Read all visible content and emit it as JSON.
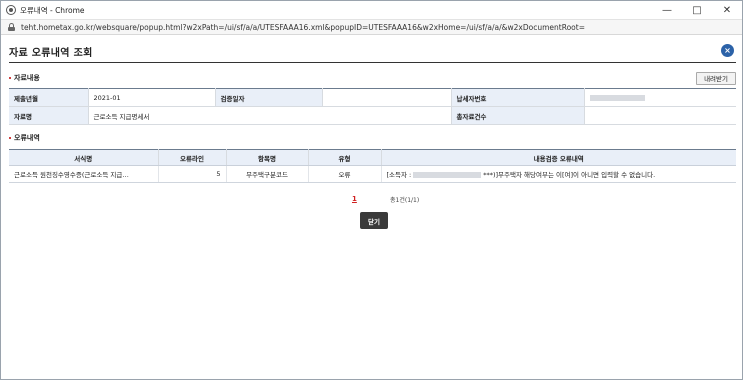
{
  "window": {
    "title": "오류내역 - Chrome",
    "url": "teht.hometax.go.kr/websquare/popup.html?w2xPath=/ui/sf/a/a/UTESFAAA16.xml&popupID=UTESFAAA16&w2xHome=/ui/sf/a/a/&w2xDocumentRoot="
  },
  "page": {
    "title": "자료 오류내역 조회",
    "close_icon": "×"
  },
  "data_section": {
    "title": "자료내용",
    "download_label": "내려받기",
    "rows": [
      {
        "label1": "제출년월",
        "value1": "2021-01",
        "label2": "검증일자",
        "value2": "",
        "label3": "납세자번호",
        "value3": ""
      },
      {
        "label1": "자료명",
        "value1": "근로소득 지급명세서",
        "label2": "",
        "value2": "",
        "label3": "총자료건수",
        "value3": ""
      }
    ]
  },
  "error_section": {
    "title": "오류내역",
    "headers": [
      "서식명",
      "오류라인",
      "항목명",
      "유형",
      "내용검증 오류내역"
    ],
    "rows": [
      {
        "form": "근로소득 원천징수영수증(근로소득 지급…",
        "line": "5",
        "item": "무주택구분코드",
        "type": "오류",
        "detail_prefix": "[소득자 :",
        "detail_suffix": "***)]무주택자 해당여부는 이[여]이 아니면 입력할 수 없습니다."
      }
    ]
  },
  "pager": {
    "page": "1",
    "count": "총1건(1/1)"
  },
  "close_button": "닫기"
}
